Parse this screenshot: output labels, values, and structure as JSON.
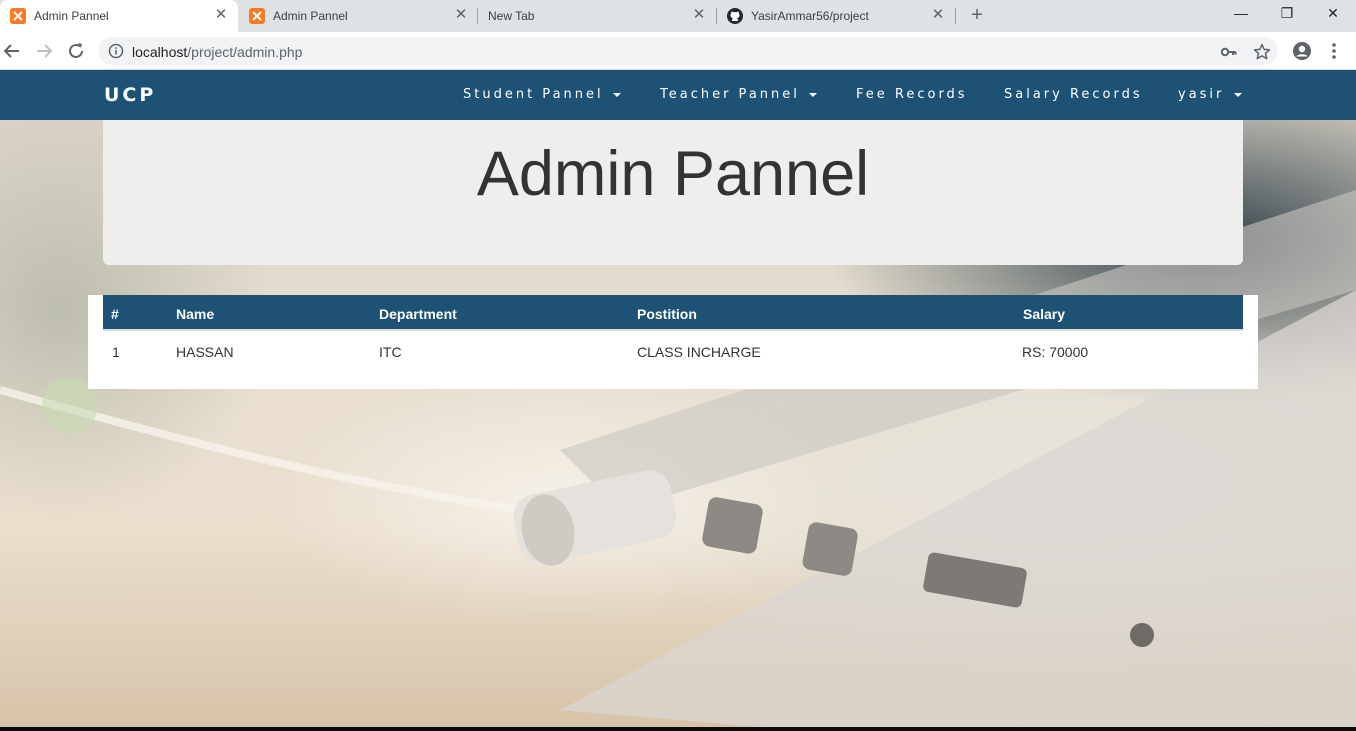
{
  "browser": {
    "tabs": [
      {
        "title": "Admin Pannel",
        "icon": "xampp-icon",
        "active": true
      },
      {
        "title": "Admin Pannel",
        "icon": "xampp-icon",
        "active": false
      },
      {
        "title": "New Tab",
        "icon": "",
        "active": false
      },
      {
        "title": "YasirAmmar56/project",
        "icon": "github-icon",
        "active": false
      }
    ],
    "new_tab_symbol": "+",
    "close_symbol": "✕",
    "window_controls": {
      "minimize": "—",
      "restore": "❐",
      "close": "✕"
    },
    "url_host": "localhost",
    "url_path": "/project/admin.php"
  },
  "navbar": {
    "brand": "UCP",
    "items": [
      {
        "label": "Student Pannel",
        "dropdown": true
      },
      {
        "label": "Teacher Pannel",
        "dropdown": true
      },
      {
        "label": "Fee Records",
        "dropdown": false
      },
      {
        "label": "Salary Records",
        "dropdown": false
      },
      {
        "label": "yasir",
        "dropdown": true
      }
    ]
  },
  "page": {
    "title": "Admin Pannel"
  },
  "table": {
    "headers": [
      "#",
      "Name",
      "Department",
      "Postition",
      "Salary"
    ],
    "rows": [
      [
        "1",
        "HASSAN",
        "ITC",
        "CLASS INCHARGE",
        "RS: 70000"
      ]
    ]
  },
  "colors": {
    "navbar": "#1d5275",
    "table_header": "#1d5275",
    "jumbotron": "#eeeeee"
  }
}
